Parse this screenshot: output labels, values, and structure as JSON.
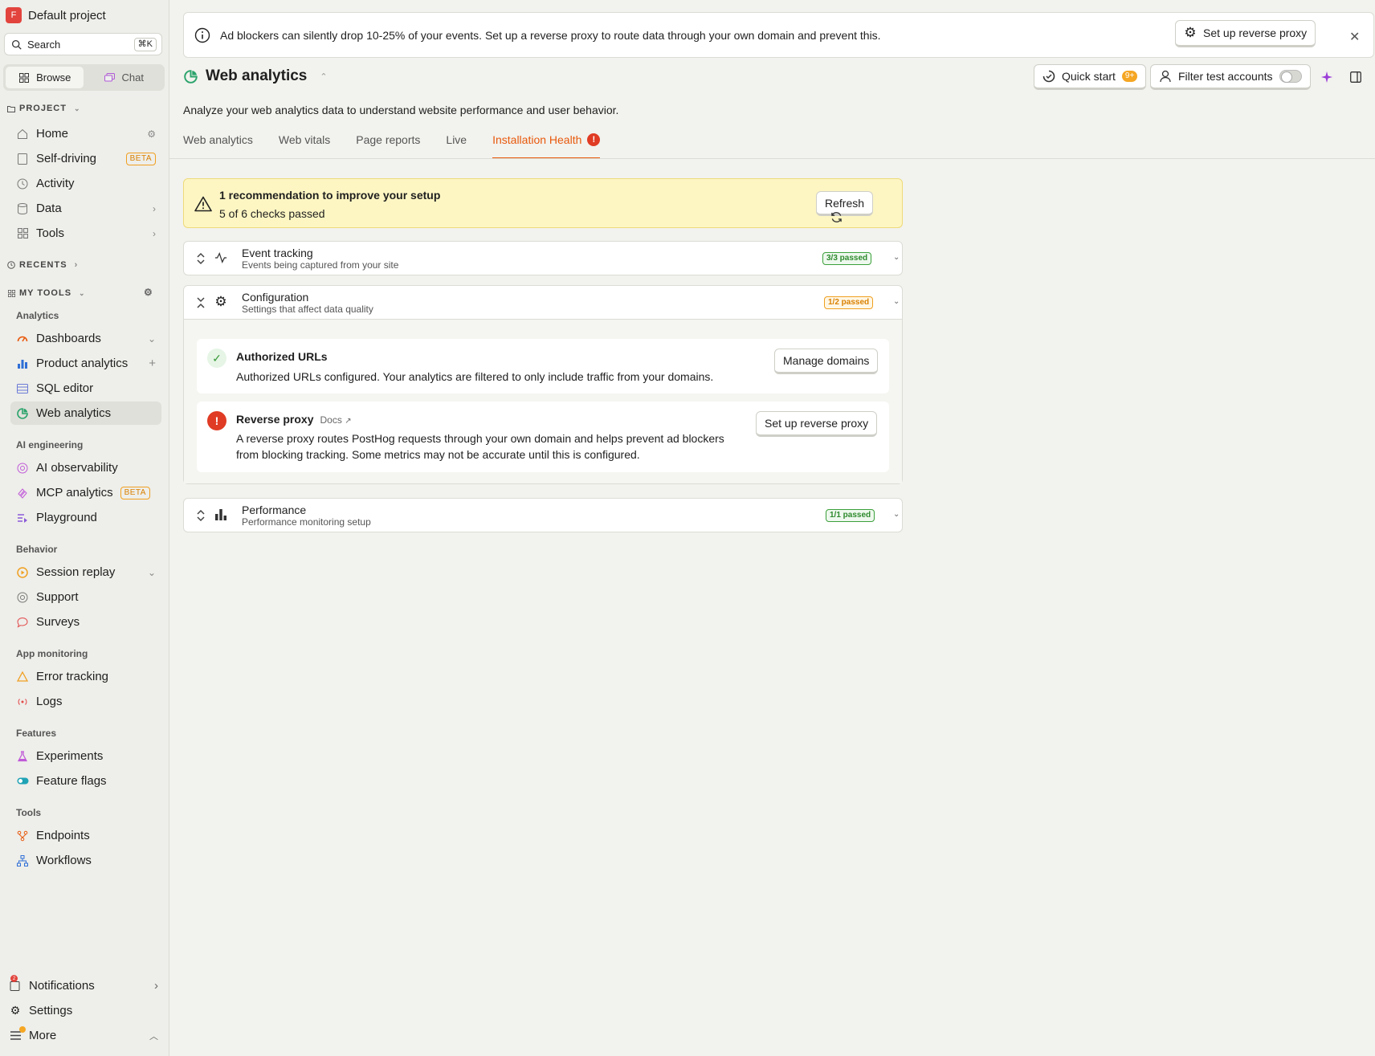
{
  "sidebar": {
    "project_initial": "F",
    "project_name": "Default project",
    "search_placeholder": "Search",
    "search_shortcut": "⌘K",
    "toggle": {
      "browse": "Browse",
      "chat": "Chat"
    },
    "project_label": "PROJECT",
    "project_items": [
      {
        "label": "Home"
      },
      {
        "label": "Self-driving",
        "badge": "BETA"
      },
      {
        "label": "Activity"
      },
      {
        "label": "Data"
      },
      {
        "label": "Tools"
      }
    ],
    "recents_label": "RECENTS",
    "mytools_label": "MY TOOLS",
    "groups": {
      "analytics": "Analytics",
      "ai": "AI engineering",
      "behavior": "Behavior",
      "app": "App monitoring",
      "features": "Features",
      "tools": "Tools"
    },
    "items": {
      "dashboards": "Dashboards",
      "product_analytics": "Product analytics",
      "sql_editor": "SQL editor",
      "web_analytics": "Web analytics",
      "ai_observability": "AI observability",
      "mcp_analytics": "MCP analytics",
      "mcp_badge": "BETA",
      "playground": "Playground",
      "session_replay": "Session replay",
      "support": "Support",
      "surveys": "Surveys",
      "error_tracking": "Error tracking",
      "logs": "Logs",
      "experiments": "Experiments",
      "feature_flags": "Feature flags",
      "endpoints": "Endpoints",
      "workflows": "Workflows"
    },
    "bottom": {
      "notifications": "Notifications",
      "notifications_count": "2",
      "settings": "Settings",
      "more": "More"
    }
  },
  "banner": {
    "message": "Ad blockers can silently drop 10-25% of your events. Set up a reverse proxy to route data through your own domain and prevent this.",
    "button": "Set up reverse proxy"
  },
  "header": {
    "title": "Web analytics",
    "subtitle": "Analyze your web analytics data to understand website performance and user behavior.",
    "quick_start": "Quick start",
    "quick_start_badge": "9+",
    "filter_test_accounts": "Filter test accounts"
  },
  "tabs": [
    "Web analytics",
    "Web vitals",
    "Page reports",
    "Live",
    "Installation Health"
  ],
  "summary": {
    "title": "1 recommendation to improve your setup",
    "detail": "5 of 6 checks passed",
    "refresh": "Refresh"
  },
  "sections": {
    "event_tracking": {
      "name": "Event tracking",
      "desc": "Events being captured from your site",
      "status": "3/3 passed"
    },
    "configuration": {
      "name": "Configuration",
      "desc": "Settings that affect data quality",
      "status": "1/2 passed"
    },
    "performance": {
      "name": "Performance",
      "desc": "Performance monitoring setup",
      "status": "1/1 passed"
    }
  },
  "checks": {
    "authorized": {
      "name": "Authorized URLs",
      "desc": "Authorized URLs configured. Your analytics are filtered to only include traffic from your domains.",
      "button": "Manage domains"
    },
    "proxy": {
      "name": "Reverse proxy",
      "docs": "Docs",
      "desc_line1": "A reverse proxy routes PostHog requests through your own domain and helps prevent ad blockers",
      "desc_line2": "from blocking tracking. Some metrics may not be accurate until this is configured.",
      "button": "Set up reverse proxy"
    }
  },
  "colors": {
    "accent": "#e8590c",
    "warning_bg": "#fdf6c3",
    "success": "#2d8a2d",
    "danger": "#e03b24"
  }
}
